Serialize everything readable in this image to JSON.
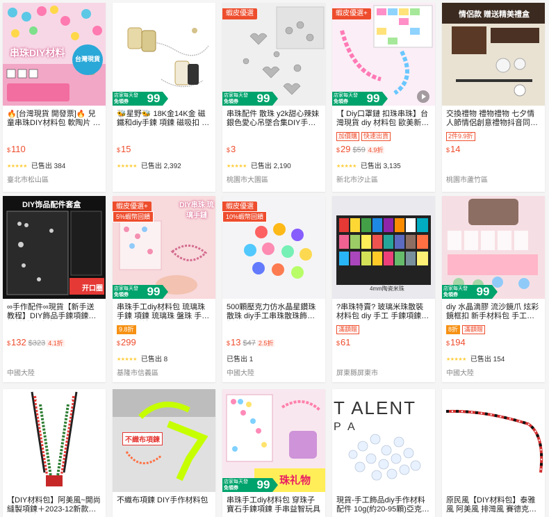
{
  "colors": {
    "accent": "#ee4d2d",
    "coupon_green": "#00a36c",
    "star": "#ffce3d"
  },
  "badge_shopee_preferred": "蝦皮優選",
  "badge_shopee_preferred_plus": "蝦皮優選+",
  "coupon": {
    "line1": "店家每天發",
    "line2": "免領券",
    "amount": "99",
    "suffix": "元起"
  },
  "products": [
    {
      "image_text": "串珠DIY材料",
      "image_text2": "台灣現貨",
      "title": "🔥[台灣現貨 開發票]🔥 兒童串珠DIY材料包 軟陶片 米珠 字母串珠",
      "price": "110",
      "sold": "已售出 384",
      "location": "臺北市松山區",
      "rating": "★★★★★"
    },
    {
      "title": "🐝星野🐝 18K金14K金 磁鐵和diy手鍊 項鍊 磁吸扣 串珠材料配件",
      "price": "15",
      "sold": "已售出 2,392",
      "location": "",
      "rating": "★★★★★"
    },
    {
      "badge": "蝦皮優選",
      "title": "串珠配件 散珠 y2k甜心辣妹銀色愛心吊墜合集DIY手工飾品配件",
      "price": "3",
      "sold": "已售出 2,190",
      "location": "桃園市大園區",
      "rating": "★★★★★"
    },
    {
      "badge": "蝦皮優選+",
      "title": "【 Diy口罩鏈 扣珠串珠】台灣現貨 diy 材料包 歐美新口罩鏈 眼鏡鏈",
      "labels": [
        "加價購",
        "快速出貨"
      ],
      "price": "29",
      "orig": "$59",
      "disc": "4.9折",
      "sold": "已售出 3,135",
      "location": "新北市汐止區",
      "rating": "★★★★★"
    },
    {
      "image_text": "情侶款 贈送精美禮盒",
      "title": "交換禮物 禮物禮物 七夕情人節情侶創意禮物抖音同款手工diy 手鍊",
      "labels": [
        "2件9.9折"
      ],
      "price": "14",
      "location": "桃園市蘆竹區"
    },
    {
      "image_text": "DIY饰品配件套盒",
      "image_text2": "开口圈",
      "title": "∞手作配件∞現貨【新手送教程】DIY飾品手鍊項鍊配件材料包 套盒",
      "price": "132",
      "orig": "$323",
      "disc": "4.1折",
      "location": "中國大陸"
    },
    {
      "badge": "蝦皮優選+",
      "badge2": "5%蝦幣回饋",
      "image_text": "DIY串珠 琉璃手鏈",
      "title": "串珠手工diy材料包 琉璃珠手鍊 項鍊 琉璃珠 盤珠 手串珠子 手鍊",
      "labels": [
        "9.8折"
      ],
      "price": "299",
      "sold": "已售出 8",
      "location": "基隆市信義區",
      "rating": "★★★★★"
    },
    {
      "badge": "蝦皮優選",
      "badge2": "10%蝦幣回饋",
      "title": "500顆壓克力仿水晶星鑽珠散珠 diy手工串珠散珠飾品製作手鍊",
      "price": "13",
      "orig": "$47",
      "disc": "2.5折",
      "sold": "已售出 1",
      "location": "中國大陸"
    },
    {
      "image_text": "4mm陶瓷米珠",
      "title": "?串珠特賣? 玻璃米珠散裝材料包 diy 手工 手鍊項鍊飾品 配件",
      "labels": [
        "滿額贈"
      ],
      "price": "61",
      "location": "屏東縣屏東市"
    },
    {
      "title": "diy 水晶滴膠 流沙鏡爪 炫彩鏡框扣 新手材料包 手工串珠 吊飾",
      "labels": [
        "8折",
        "滿額贈"
      ],
      "price": "194",
      "sold": "已售出 154",
      "location": "中國大陸",
      "rating": "★★★★★"
    },
    {
      "title": "【DIY材料包】阿美風~開尚縫製項鍊＋2023-12新款＋手工串珠",
      "price": "",
      "location": ""
    },
    {
      "image_text": "不織布項鍊",
      "title": "不織布項鍊 DIY手作材料包",
      "price": "",
      "location": ""
    },
    {
      "image_text": "珠礼物",
      "title": "串珠手工diy材料包 穿珠子寶石手鍊項鍊 手串益智玩具",
      "price": "",
      "location": ""
    },
    {
      "image_text": "T ALENT",
      "image_text2": "P A",
      "title": "現貨-手工飾品diy手作材料配件 10g(約20-95顆)亞克力透明AB散珠",
      "price": "",
      "location": ""
    },
    {
      "title": "原民風【DIY材料包】泰雅風 阿美風 排灣風 賽德克風...琉璃珠串",
      "price": "",
      "location": ""
    }
  ]
}
